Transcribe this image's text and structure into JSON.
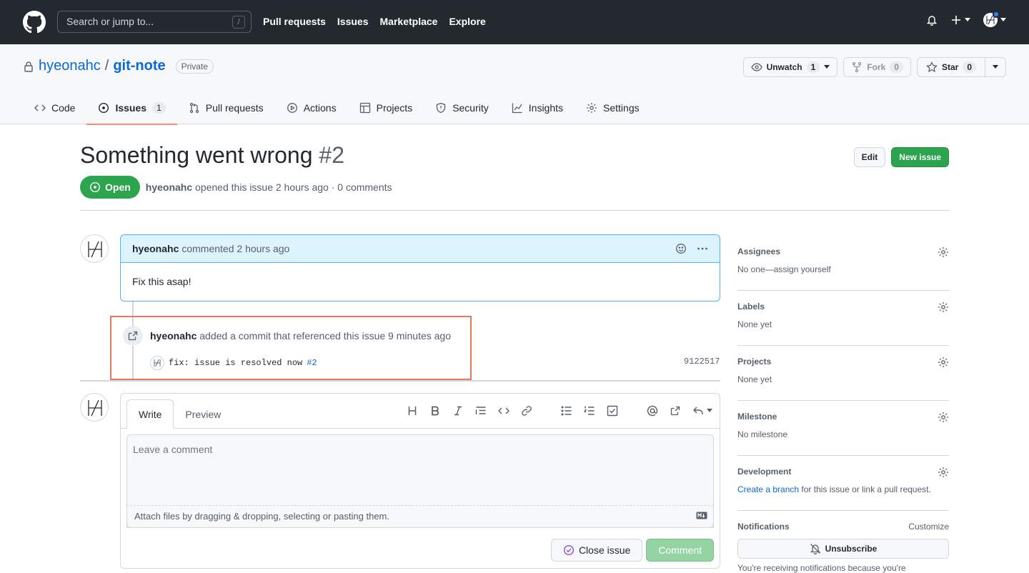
{
  "header": {
    "search_placeholder": "Search or jump to...",
    "search_shortcut": "/",
    "nav": [
      "Pull requests",
      "Issues",
      "Marketplace",
      "Explore"
    ]
  },
  "repo": {
    "owner": "hyeonahc",
    "separator": "/",
    "name": "git-note",
    "visibility": "Private",
    "unwatch_label": "Unwatch",
    "unwatch_count": "1",
    "fork_label": "Fork",
    "fork_count": "0",
    "star_label": "Star",
    "star_count": "0"
  },
  "tabs": [
    {
      "label": "Code",
      "icon": "code-icon"
    },
    {
      "label": "Issues",
      "icon": "issue-opened-icon",
      "count": "1"
    },
    {
      "label": "Pull requests",
      "icon": "git-pull-request-icon"
    },
    {
      "label": "Actions",
      "icon": "play-icon"
    },
    {
      "label": "Projects",
      "icon": "table-icon"
    },
    {
      "label": "Security",
      "icon": "shield-icon"
    },
    {
      "label": "Insights",
      "icon": "graph-icon"
    },
    {
      "label": "Settings",
      "icon": "gear-icon"
    }
  ],
  "issue": {
    "title": "Something went wrong",
    "number": "#2",
    "edit_label": "Edit",
    "new_issue_label": "New issue",
    "state": "Open",
    "author": "hyeonahc",
    "meta": "opened this issue 2 hours ago · 0 comments"
  },
  "comment": {
    "author": "hyeonahc",
    "action": "commented 2 hours ago",
    "body": "Fix this asap!"
  },
  "event": {
    "author": "hyeonahc",
    "text": "added a commit that referenced this issue 9 minutes ago",
    "commit_message": "fix: issue is resolved now",
    "commit_ref": "#2",
    "sha": "9122517"
  },
  "form": {
    "write_tab": "Write",
    "preview_tab": "Preview",
    "placeholder": "Leave a comment",
    "attach_text": "Attach files by dragging & dropping, selecting or pasting them.",
    "close_issue_label": "Close issue",
    "comment_label": "Comment"
  },
  "sidebar": {
    "assignees_title": "Assignees",
    "assignees_value": "No one—assign yourself",
    "labels_title": "Labels",
    "labels_value": "None yet",
    "projects_title": "Projects",
    "projects_value": "None yet",
    "milestone_title": "Milestone",
    "milestone_value": "No milestone",
    "development_title": "Development",
    "development_link": "Create a branch",
    "development_rest": " for this issue or link a pull request.",
    "notifications_title": "Notifications",
    "customize_label": "Customize",
    "unsubscribe_label": "Unsubscribe",
    "notifications_note": "You're receiving notifications because you're"
  },
  "colors": {
    "header_bg": "#24292f",
    "open_green": "#2da44e",
    "link_blue": "#0969da",
    "highlight_border": "#e07b5d",
    "comment_header_bg": "#ddf4ff"
  }
}
